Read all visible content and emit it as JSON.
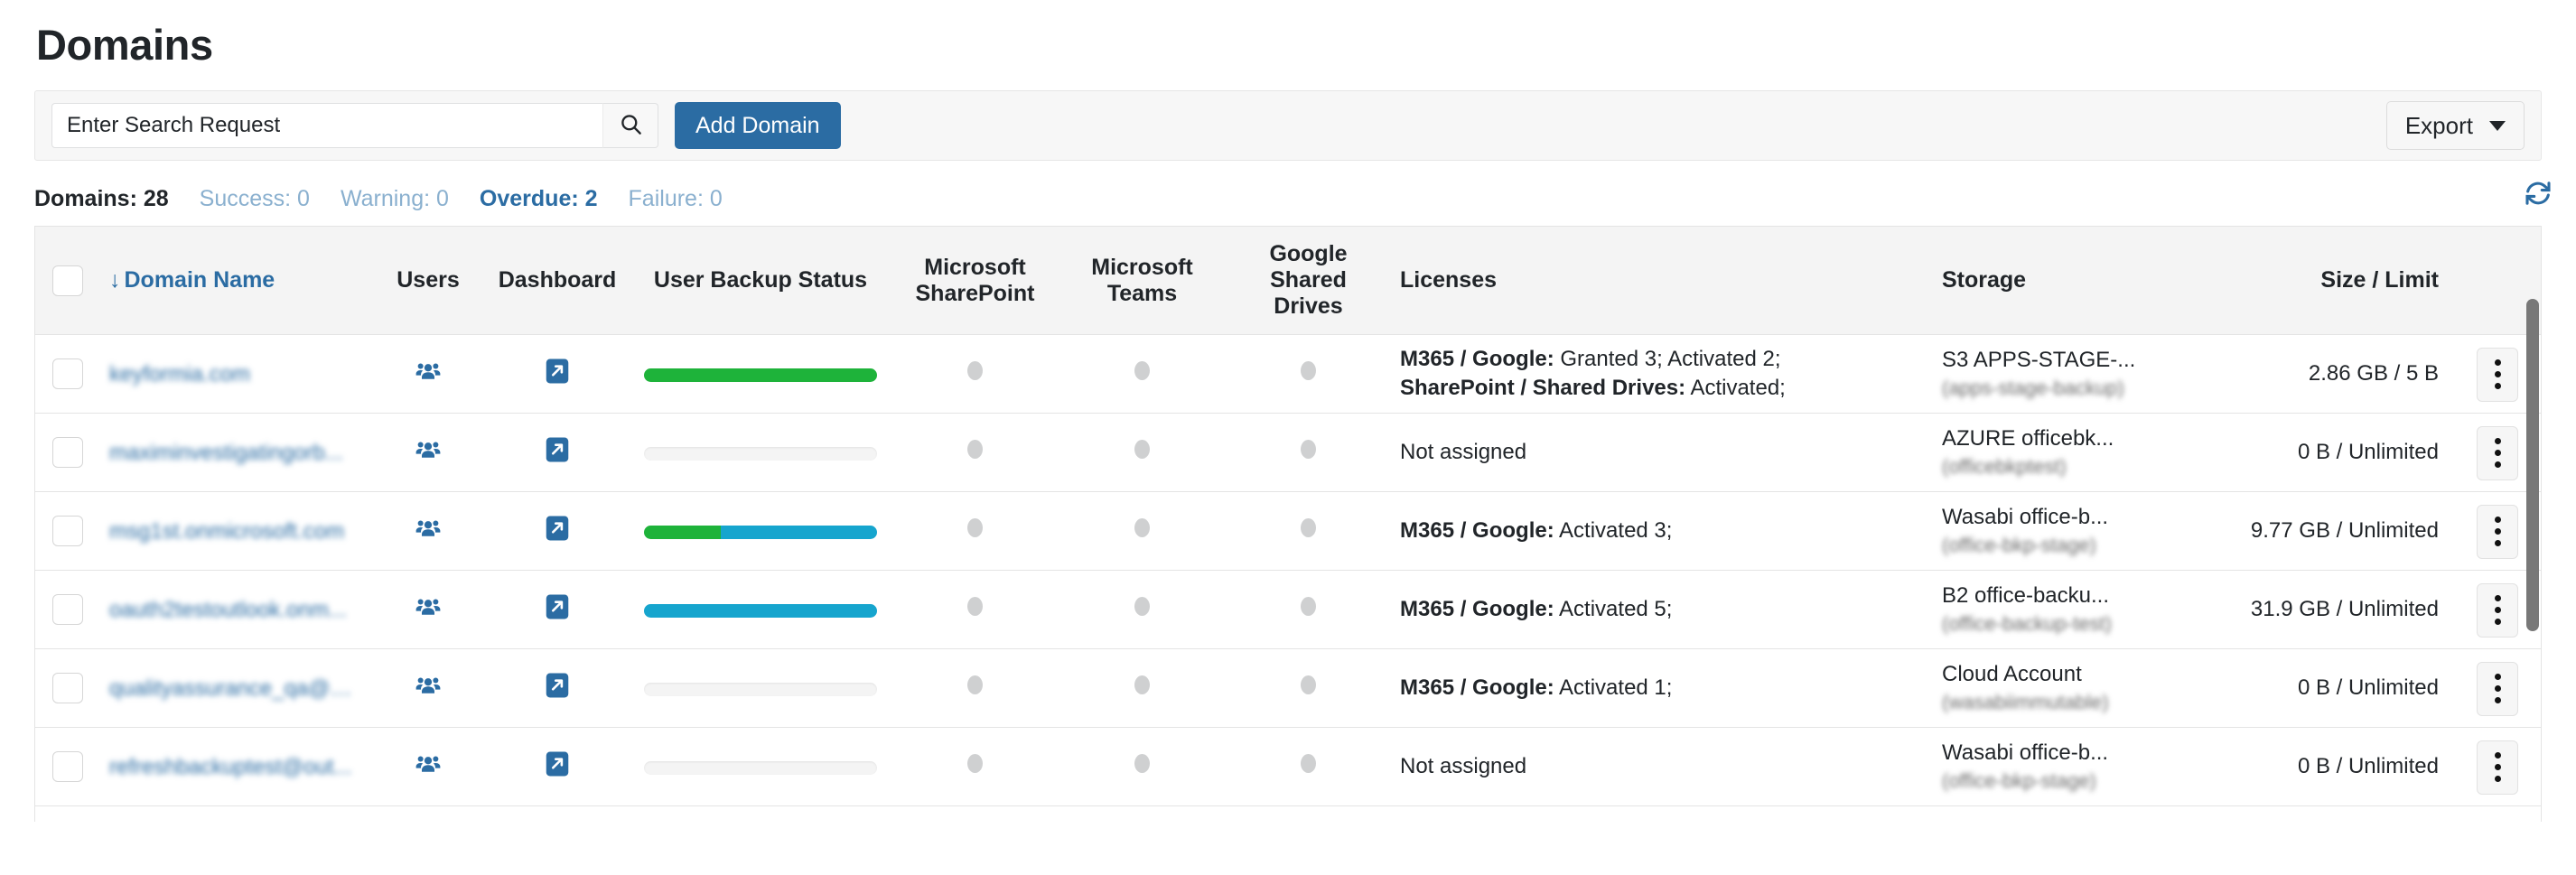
{
  "page": {
    "title": "Domains"
  },
  "toolbar": {
    "search_placeholder": "Enter Search Request",
    "search_value": "",
    "search_icon": "search-icon",
    "add_domain_label": "Add Domain",
    "export_label": "Export",
    "export_caret_icon": "chevron-down-icon"
  },
  "status": {
    "domains_label": "Domains: 28",
    "success_label": "Success: 0",
    "warning_label": "Warning: 0",
    "overdue_label": "Overdue: 2",
    "failure_label": "Failure: 0",
    "refresh_icon": "refresh-icon"
  },
  "colors": {
    "accent": "#2b6ca3",
    "muted_link": "#8ab0cf",
    "progress_green": "#1eb33a",
    "progress_blue": "#16a5ce",
    "dot_gray": "#cfd0d1",
    "header_bg": "#f4f4f4"
  },
  "table": {
    "sort_arrow": "↓",
    "columns": [
      {
        "key": "check",
        "label": ""
      },
      {
        "key": "domain",
        "label": "Domain Name"
      },
      {
        "key": "users",
        "label": "Users"
      },
      {
        "key": "dash",
        "label": "Dashboard"
      },
      {
        "key": "ubs",
        "label": "User Backup Status"
      },
      {
        "key": "sp",
        "label": "Microsoft SharePoint"
      },
      {
        "key": "teams",
        "label": "Microsoft Teams"
      },
      {
        "key": "gsd",
        "label": "Google Shared Drives"
      },
      {
        "key": "lic",
        "label": "Licenses"
      },
      {
        "key": "stor",
        "label": "Storage"
      },
      {
        "key": "size",
        "label": "Size / Limit"
      },
      {
        "key": "act",
        "label": ""
      }
    ],
    "header": {
      "domain": "Domain Name",
      "users": "Users",
      "dashboard": "Dashboard",
      "user_backup_status": "User Backup Status",
      "sharepoint_line1": "Microsoft",
      "sharepoint_line2": "SharePoint",
      "teams_line1": "Microsoft",
      "teams_line2": "Teams",
      "gsd_line1": "Google",
      "gsd_line2": "Shared",
      "gsd_line3": "Drives",
      "licenses": "Licenses",
      "storage": "Storage",
      "size_limit": "Size / Limit"
    },
    "rows": [
      {
        "domain": "keyformia.com",
        "users_icon": "users-group-icon",
        "dashboard_icon": "external-link-icon",
        "backup_segments": [
          {
            "color": "green",
            "pct": 100
          }
        ],
        "sharepoint_status": "inactive",
        "teams_status": "inactive",
        "gsd_status": "inactive",
        "licenses_lines": [
          {
            "strong": "M365 / Google:",
            "rest": " Granted 3; Activated 2;"
          },
          {
            "strong": "SharePoint / Shared Drives:",
            "rest": " Activated;"
          }
        ],
        "storage_main": "S3 APPS-STAGE-...",
        "storage_sub": "(apps-stage-backup)",
        "size_limit": "2.86 GB / 5 B",
        "actions_icon": "kebab-menu-icon"
      },
      {
        "domain": "maximinvestigatingorb...",
        "users_icon": "users-group-icon",
        "dashboard_icon": "external-link-icon",
        "backup_segments": [],
        "sharepoint_status": "inactive",
        "teams_status": "inactive",
        "gsd_status": "inactive",
        "licenses_lines": [
          {
            "strong": "",
            "rest": "Not assigned"
          }
        ],
        "storage_main": "AZURE officebk...",
        "storage_sub": "(officebkptest)",
        "size_limit": "0 B / Unlimited",
        "actions_icon": "kebab-menu-icon"
      },
      {
        "domain": "msg1st.onmicrosoft.com",
        "users_icon": "users-group-icon",
        "dashboard_icon": "external-link-icon",
        "backup_segments": [
          {
            "color": "green",
            "pct": 33
          },
          {
            "color": "blue",
            "pct": 67
          }
        ],
        "sharepoint_status": "inactive",
        "teams_status": "inactive",
        "gsd_status": "inactive",
        "licenses_lines": [
          {
            "strong": "M365 / Google:",
            "rest": " Activated 3;"
          }
        ],
        "storage_main": "Wasabi office-b...",
        "storage_sub": "(office-bkp-stage)",
        "size_limit": "9.77 GB / Unlimited",
        "actions_icon": "kebab-menu-icon"
      },
      {
        "domain": "oauth2testoutlook.onm...",
        "users_icon": "users-group-icon",
        "dashboard_icon": "external-link-icon",
        "backup_segments": [
          {
            "color": "blue",
            "pct": 100
          }
        ],
        "sharepoint_status": "inactive",
        "teams_status": "inactive",
        "gsd_status": "inactive",
        "licenses_lines": [
          {
            "strong": "M365 / Google:",
            "rest": " Activated 5;"
          }
        ],
        "storage_main": "B2 office-backu...",
        "storage_sub": "(office-backup-test)",
        "size_limit": "31.9 GB / Unlimited",
        "actions_icon": "kebab-menu-icon"
      },
      {
        "domain": "qualityassurance_qa@o...",
        "users_icon": "users-group-icon",
        "dashboard_icon": "external-link-icon",
        "backup_segments": [],
        "sharepoint_status": "inactive",
        "teams_status": "inactive",
        "gsd_status": "inactive",
        "licenses_lines": [
          {
            "strong": "M365 / Google:",
            "rest": " Activated 1;"
          }
        ],
        "storage_main": "Cloud Account",
        "storage_sub": "(wasabiimmutable)",
        "size_limit": "0 B / Unlimited",
        "actions_icon": "kebab-menu-icon"
      },
      {
        "domain": "refreshbackuptest@out...",
        "users_icon": "users-group-icon",
        "dashboard_icon": "external-link-icon",
        "backup_segments": [],
        "sharepoint_status": "inactive",
        "teams_status": "inactive",
        "gsd_status": "inactive",
        "licenses_lines": [
          {
            "strong": "",
            "rest": "Not assigned"
          }
        ],
        "storage_main": "Wasabi office-b...",
        "storage_sub": "(office-bkp-stage)",
        "size_limit": "0 B / Unlimited",
        "actions_icon": "kebab-menu-icon"
      }
    ]
  }
}
